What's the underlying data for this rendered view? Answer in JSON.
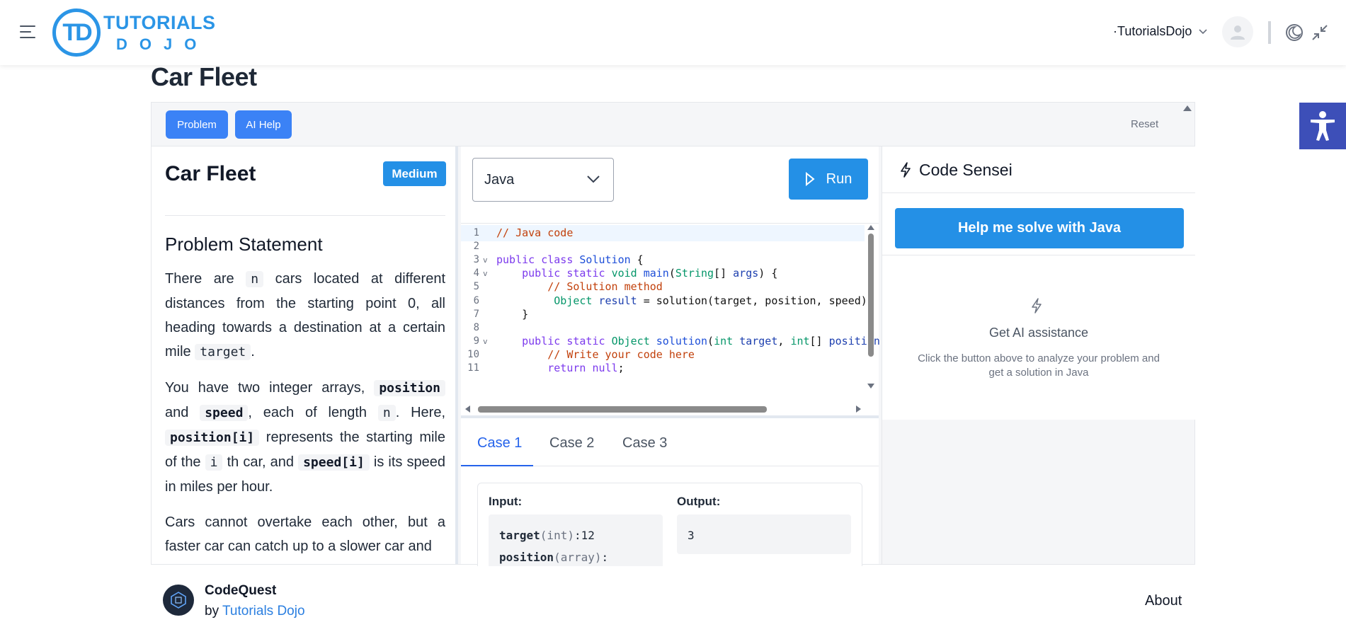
{
  "header": {
    "logo_top": "TUTORIALS",
    "logo_bottom": "DOJO",
    "logo_mark": "TD",
    "user": "·TutorialsDojo"
  },
  "page": {
    "title": "Car Fleet"
  },
  "toolbar": {
    "problem": "Problem",
    "ai_help": "AI Help",
    "reset": "Reset"
  },
  "problem": {
    "title": "Car Fleet",
    "difficulty": "Medium",
    "section_heading": "Problem Statement",
    "p1": {
      "a": "There are",
      "n": "n",
      "b": "cars located at different distances from the starting point 0, all heading towards a destination at a certain mile",
      "target": "target",
      "c": "."
    },
    "p2": {
      "a": "You have two integer arrays,",
      "position": "position",
      "b": "and",
      "speed": "speed",
      "c": ", each of length",
      "n": "n",
      "d": ". Here,",
      "position_i": "position[i]",
      "e": "represents the starting mile of the",
      "i": "i",
      "f": "th car, and",
      "speed_i": "speed[i]",
      "g": "is its speed in miles per hour."
    },
    "p3": "Cars cannot overtake each other, but a faster car can catch up to a slower car and"
  },
  "editor": {
    "language": "Java",
    "run": "Run",
    "lines": [
      {
        "n": "1",
        "html": "<span class=\"cm\">// Java code</span>"
      },
      {
        "n": "2",
        "html": ""
      },
      {
        "n": "3",
        "html": "<span class=\"k\">public</span> <span class=\"k\">class</span> <span class=\"fn\">Solution</span> {"
      },
      {
        "n": "4",
        "html": "    <span class=\"k\">public</span> <span class=\"k\">static</span> <span class=\"kg\">void</span> <span class=\"fn\">main</span>(<span class=\"kg\">String</span>[] <span class=\"vr\">args</span>) {"
      },
      {
        "n": "5",
        "html": "        <span class=\"cm\">// Solution method</span>"
      },
      {
        "n": "6",
        "html": "         <span class=\"kg\">Object</span> <span class=\"vr\">result</span> = solution(target, position, speed);"
      },
      {
        "n": "7",
        "html": "    }"
      },
      {
        "n": "8",
        "html": ""
      },
      {
        "n": "9",
        "html": "    <span class=\"k\">public</span> <span class=\"k\">static</span> <span class=\"kg\">Object</span> <span class=\"fn\">solution</span>(<span class=\"kg\">int</span> <span class=\"vr\">target</span>, <span class=\"kg\">int</span>[] <span class=\"vr\">position</span>"
      },
      {
        "n": "10",
        "html": "        <span class=\"cm\">// Write your code here</span>"
      },
      {
        "n": "11",
        "html": "        <span class=\"k\">return</span> <span class=\"k\">null</span>;"
      }
    ]
  },
  "cases": {
    "tabs": [
      "Case 1",
      "Case 2",
      "Case 3"
    ],
    "input_label": "Input:",
    "output_label": "Output:",
    "input_line1_key": "target",
    "input_line1_type": "(int)",
    "input_line1_val": ":12",
    "input_line2_key": "position",
    "input_line2_type": "(array)",
    "input_line2_val": ":",
    "output": "3"
  },
  "sensei": {
    "title": "Code Sensei",
    "help_button": "Help me solve with Java",
    "empty_title": "Get AI assistance",
    "empty_desc": "Click the button above to analyze your problem and get a solution in Java"
  },
  "footer": {
    "name": "CodeQuest",
    "by": "by",
    "by_link": "Tutorials Dojo",
    "about": "About"
  },
  "colors": {
    "brand": "#2b95e6",
    "primary": "#2490e6",
    "accessibility": "#3d4fb8"
  }
}
